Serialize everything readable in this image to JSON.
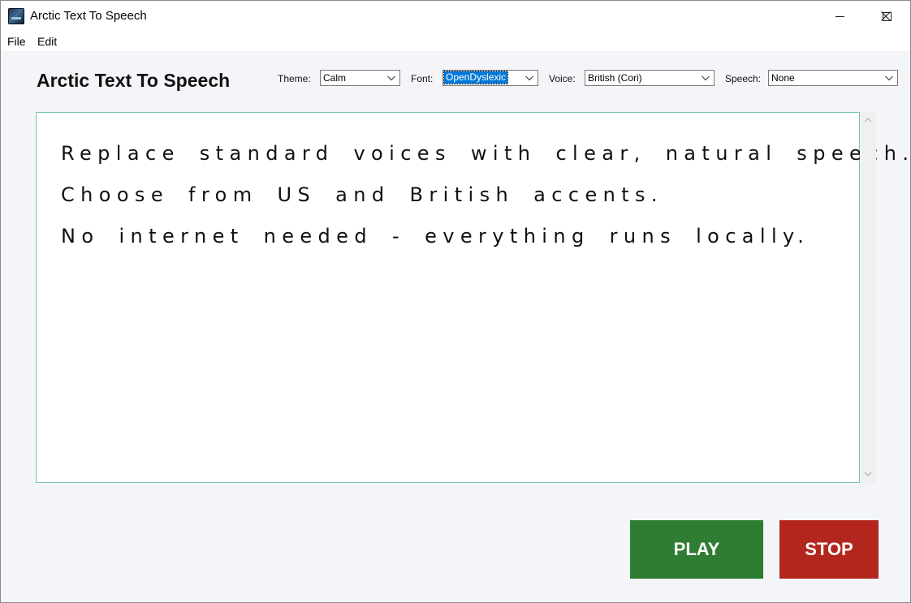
{
  "window": {
    "title": "Arctic Text To Speech"
  },
  "menu": {
    "items": [
      "File",
      "Edit"
    ]
  },
  "header": {
    "app_title": "Arctic Text To Speech"
  },
  "controls": {
    "theme": {
      "label": "Theme:",
      "value": "Calm"
    },
    "font": {
      "label": "Font:",
      "value": "OpenDyslexic"
    },
    "voice": {
      "label": "Voice:",
      "value": "British (Cori)"
    },
    "speech": {
      "label": "Speech:",
      "value": "None"
    }
  },
  "editor": {
    "lines": [
      "Replace standard voices with clear, natural speech.",
      "Choose from US and British accents.",
      "No internet needed - everything runs locally."
    ]
  },
  "buttons": {
    "play": "PLAY",
    "stop": "STOP"
  },
  "colors": {
    "play": "#2e7d32",
    "stop": "#b3261e",
    "editor_border": "#7cc3b2",
    "selection": "#0078d7"
  }
}
